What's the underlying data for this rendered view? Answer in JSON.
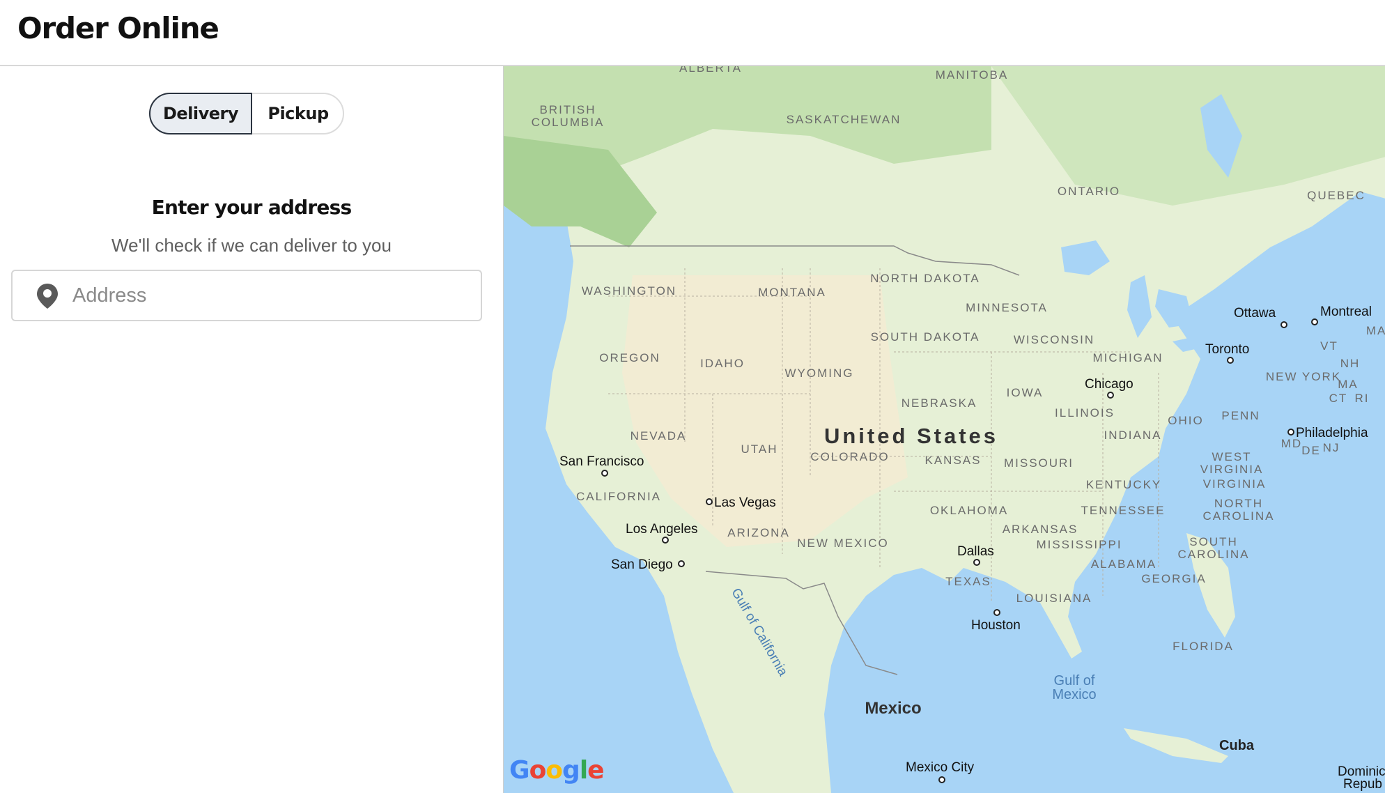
{
  "header": {
    "title": "Order Online"
  },
  "toggle": {
    "delivery_label": "Delivery",
    "pickup_label": "Pickup",
    "selected": "Delivery"
  },
  "address": {
    "title": "Enter your address",
    "subtitle": "We'll check if we can deliver to you",
    "placeholder": "Address",
    "value": ""
  },
  "map": {
    "provider_logo": "Google",
    "country_labels": [
      "United States",
      "Mexico",
      "Cuba"
    ],
    "water_labels": [
      "Gulf of California",
      "Gulf of Mexico"
    ],
    "region_labels": [
      "ALBERTA",
      "MANITOBA",
      "BRITISH COLUMBIA",
      "SASKATCHEWAN",
      "ONTARIO",
      "QUEBEC",
      "WASHINGTON",
      "MONTANA",
      "NORTH DAKOTA",
      "MINNESOTA",
      "OREGON",
      "IDAHO",
      "WYOMING",
      "SOUTH DAKOTA",
      "WISCONSIN",
      "MICHIGAN",
      "IOWA",
      "NEBRASKA",
      "ILLINOIS",
      "INDIANA",
      "OHIO",
      "PENN",
      "NEW YORK",
      "NEVADA",
      "UTAH",
      "COLORADO",
      "KANSAS",
      "MISSOURI",
      "CALIFORNIA",
      "ARIZONA",
      "NEW MEXICO",
      "OKLAHOMA",
      "KENTUCKY",
      "WEST VIRGINIA",
      "VIRGINIA",
      "TENNESSEE",
      "NORTH CAROLINA",
      "ARKANSAS",
      "MISSISSIPPI",
      "ALABAMA",
      "SOUTH CAROLINA",
      "GEORGIA",
      "TEXAS",
      "LOUISIANA",
      "FLORIDA",
      "MAI",
      "VT",
      "NH",
      "MA",
      "CT",
      "RI",
      "MD",
      "DE",
      "NJ"
    ],
    "city_labels": [
      "Ottawa",
      "Montreal",
      "Toronto",
      "Chicago",
      "Philadelphia",
      "San Francisco",
      "Las Vegas",
      "Los Angeles",
      "San Diego",
      "Dallas",
      "Houston",
      "Mexico City"
    ],
    "partial_labels": [
      "Dominic",
      "Repub"
    ],
    "colors": {
      "water": "#a8d4f6",
      "land": "#e6f0d6",
      "forest": "#b6d9a2",
      "us_interior": "#f2ecd3",
      "accent": "#2b3440"
    }
  }
}
